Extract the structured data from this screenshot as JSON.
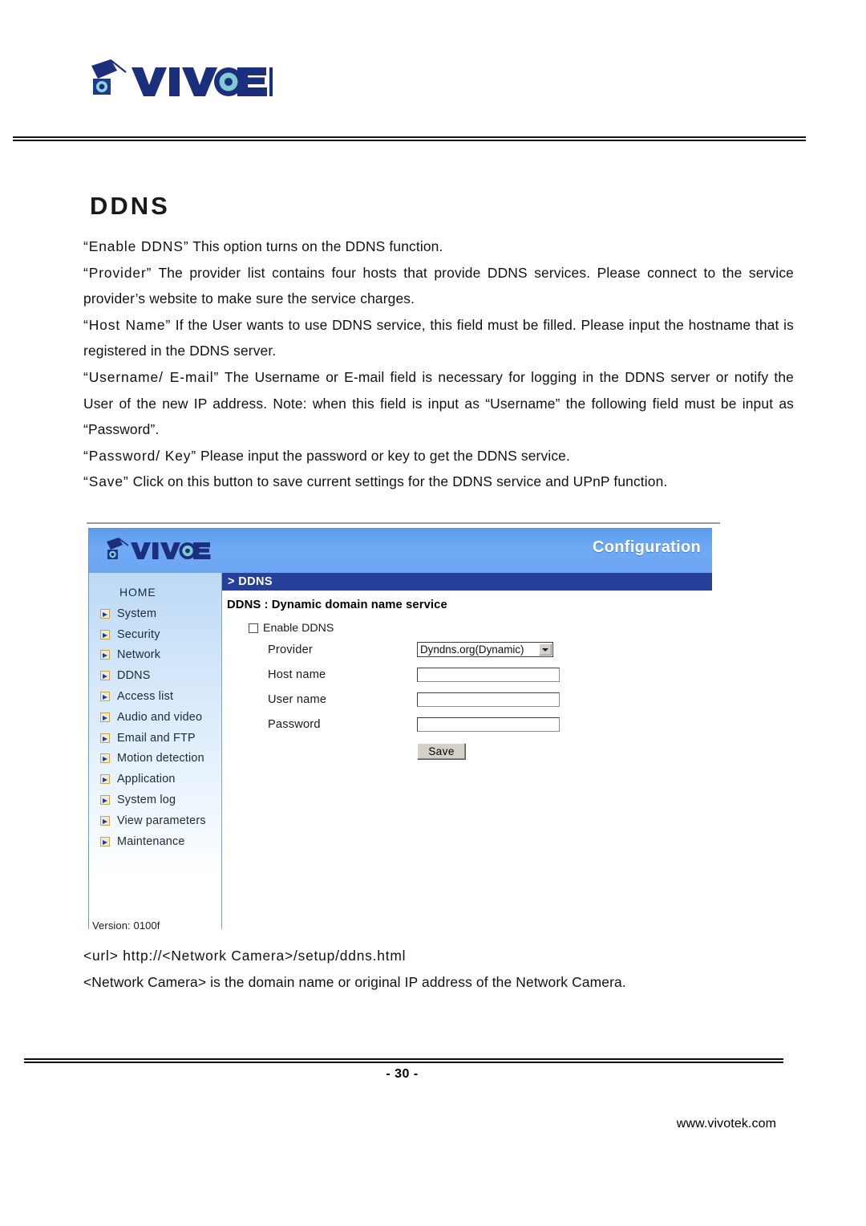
{
  "brand": {
    "logo_icon": "vivotek-camera-logo-icon",
    "wordmark": "VIVOTEK"
  },
  "page": {
    "title": "DDNS",
    "number": "- 30 -",
    "website": "www.vivotek.com"
  },
  "body": {
    "paragraphs": [
      {
        "term": "“Enable DDNS”",
        "text": " This option turns on the DDNS function."
      },
      {
        "term": "“Provider”",
        "text": " The provider list contains four hosts that provide DDNS services. Please connect to the service provider’s website to make sure the service charges."
      },
      {
        "term": "“Host Name”",
        "text": " If the User wants to use DDNS service, this field must be filled. Please input the hostname that is registered in the DDNS server."
      },
      {
        "term": "“Username/ E-mail”",
        "text": " The Username or E-mail field is necessary for logging in the DDNS server or notify the User of the new IP address. Note: when this field is input as “Username” the following field must be input as “Password”."
      },
      {
        "term": "“Password/ Key”",
        "text": " Please input the password or key to get the DDNS service."
      },
      {
        "term": "“Save”",
        "text": " Click on this button to save current settings for the DDNS service and UPnP function."
      }
    ]
  },
  "url_notes": {
    "line1": "<url> http://<Network Camera>/setup/ddns.html",
    "line2": "<Network Camera> is the domain name or original IP address of the Network Camera."
  },
  "screenshot": {
    "banner": {
      "logo_icon": "vivotek-camera-logo-icon",
      "title": "Configuration"
    },
    "sidebar": {
      "home_label": "HOME",
      "items": [
        {
          "label": "System",
          "icon": "arrow-box-icon"
        },
        {
          "label": "Security",
          "icon": "arrow-box-icon"
        },
        {
          "label": "Network",
          "icon": "arrow-box-icon"
        },
        {
          "label": "DDNS",
          "icon": "arrow-box-icon"
        },
        {
          "label": "Access list",
          "icon": "arrow-box-icon"
        },
        {
          "label": "Audio and video",
          "icon": "arrow-box-icon"
        },
        {
          "label": "Email and FTP",
          "icon": "arrow-box-icon"
        },
        {
          "label": "Motion detection",
          "icon": "arrow-box-icon"
        },
        {
          "label": "Application",
          "icon": "arrow-box-icon"
        },
        {
          "label": "System log",
          "icon": "arrow-box-icon"
        },
        {
          "label": "View parameters",
          "icon": "arrow-box-icon"
        },
        {
          "label": "Maintenance",
          "icon": "arrow-box-icon"
        }
      ],
      "version": "Version: 0100f"
    },
    "content": {
      "breadcrumb": "> DDNS",
      "section_title": "DDNS : Dynamic domain name service",
      "enable_checkbox_label": "Enable DDNS",
      "enable_checkbox_checked": false,
      "fields": [
        {
          "label": "Provider",
          "type": "select",
          "value": "Dyndns.org(Dynamic)"
        },
        {
          "label": "Host name",
          "type": "text",
          "value": ""
        },
        {
          "label": "User name",
          "type": "text",
          "value": ""
        },
        {
          "label": "Password",
          "type": "password",
          "value": ""
        }
      ],
      "save_label": "Save"
    },
    "colors": {
      "banner_blue": "#6ba5f2",
      "breadcrumb_blue": "#25409a",
      "sidebar_blue": "#bcd9f5",
      "icon_gold": "#c9a44a"
    }
  }
}
